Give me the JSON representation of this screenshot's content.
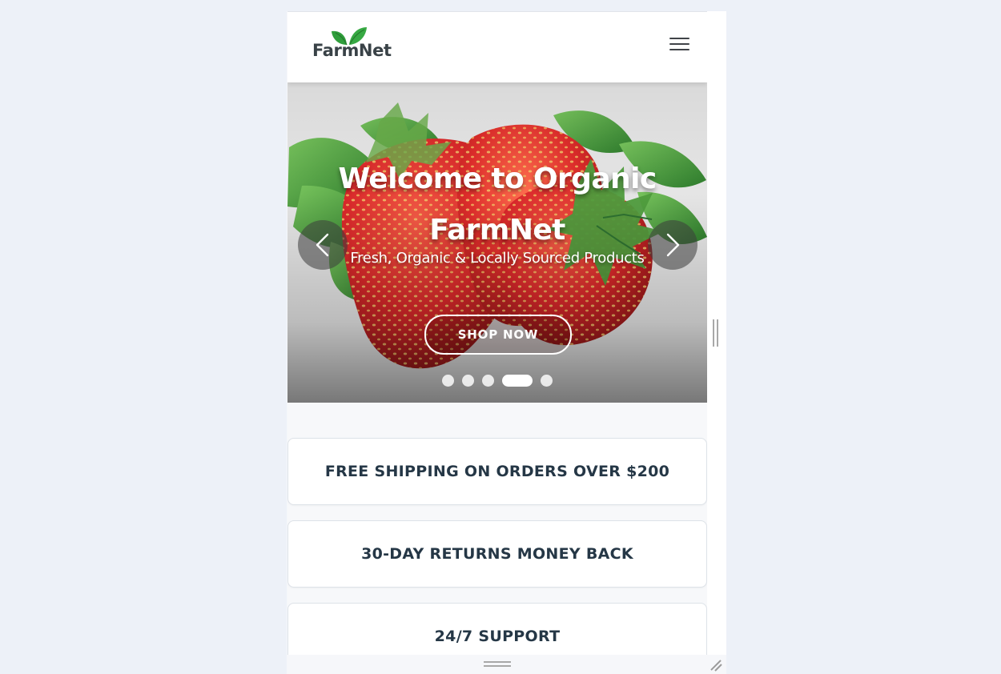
{
  "header": {
    "logo_text": "FarmNet",
    "menu_icon": "hamburger-menu-icon"
  },
  "hero": {
    "title": "Welcome to Organic FarmNet",
    "subtitle": "Fresh, Organic & Locally Sourced Products",
    "button": "SHOP NOW",
    "image_subject": "strawberries",
    "prev_icon": "chevron-left-icon",
    "next_icon": "chevron-right-icon",
    "slides": {
      "count": 5,
      "active_index": 3
    }
  },
  "features": [
    {
      "label": "FREE SHIPPING ON ORDERS OVER $200"
    },
    {
      "label": "30-DAY RETURNS MONEY BACK"
    },
    {
      "label": "24/7 SUPPORT"
    }
  ],
  "resize_controls": {
    "right_icon": "vertical-resize-handle-icon",
    "bottom_icon": "horizontal-resize-handle-icon",
    "corner_icon": "diagonal-resize-grip-icon"
  },
  "colors": {
    "logo_leaf": "#2f9e3b",
    "text_dark": "#253746",
    "page_background": "#edf1f8",
    "hero_button_outline": "#ffffff"
  }
}
